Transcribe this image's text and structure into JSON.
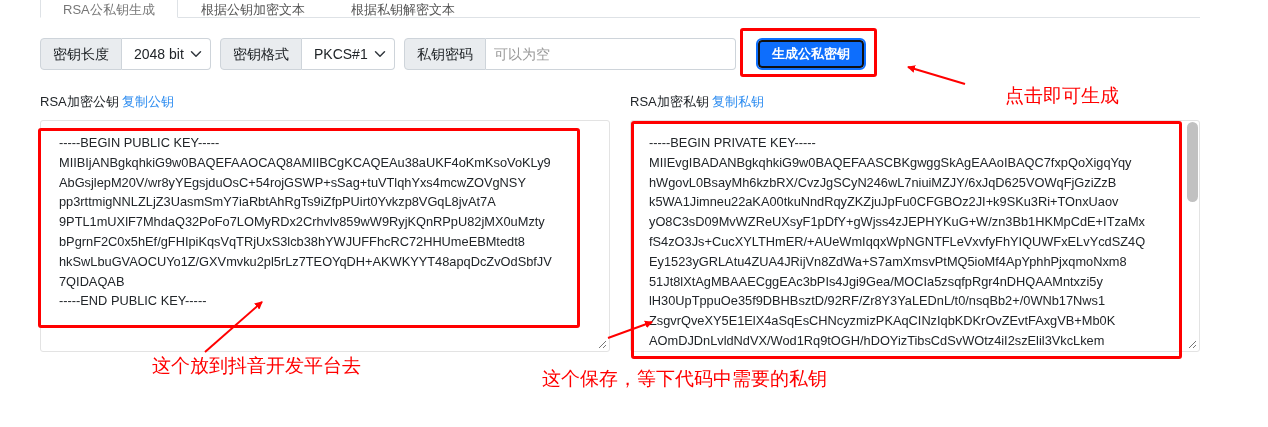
{
  "tabs": [
    {
      "label": "RSA公私钥生成",
      "selected": true
    },
    {
      "label": "根据公钥加密文本",
      "selected": false
    },
    {
      "label": "根据私钥解密文本",
      "selected": false
    }
  ],
  "options": [
    {
      "kind": "select",
      "label": "密钥长度",
      "value": "2048 bit"
    },
    {
      "kind": "select",
      "label": "密钥格式",
      "value": "PKCS#1"
    },
    {
      "kind": "input",
      "label": "私钥密码",
      "placeholder": "可以为空"
    }
  ],
  "generate_button": "生成公私密钥",
  "public_key": {
    "label": "RSA加密公钥",
    "copy_link": "复制公钥",
    "lines": [
      "-----BEGIN PUBLIC KEY-----",
      "MIIBIjANBgkqhkiG9w0BAQEFAAOCAQ8AMIIBCgKCAQEAu38aUKF4oKmKsoVoKLy9",
      "AbGsjlepM20V/wr8yYEgsjduOsC+54rojGSWP+sSag+tuVTlqhYxs4mcwZOVgNSY",
      "pp3rttmigNNLZLjZ3UasmSmY7iaRbtAhRgTs9iZfpPUirt0Yvkzp8VGqL8jvAt7A",
      "9PTL1mUXlF7MhdaQ32PoFo7LOMyRDx2Crhvlv859wW9RyjKQnRPpU82jMX0uMzty",
      "bPgrnF2C0x5hEf/gFHIpiKqsVqTRjUxS3lcb38hYWJUFFhcRC72HHUmeEBMtedt8",
      "hkSwLbuGVAOCUYo1Z/GXVmvku2pl5rLz7TEOYqDH+AKWKYYT48apqDcZvOdSbfJV",
      "7QIDAQAB",
      "-----END PUBLIC KEY-----"
    ]
  },
  "private_key": {
    "label": "RSA加密私钥",
    "copy_link": "复制私钥",
    "lines": [
      "-----BEGIN PRIVATE KEY-----",
      "MIIEvgIBADANBgkqhkiG9w0BAQEFAASCBKgwggSkAgEAAoIBAQC7fxpQoXigqYqy",
      "hWgovL0BsayMh6kzbRX/CvzJgSCyN246wL7niuiMZJY/6xJqD625VOWqFjGziZzB",
      "k5WA1Jimneu22aKA00tkuNndRqyZKZjuJpFu0CFGBOz2JI+k9SKu3Ri+TOnxUaov",
      "yO8C3sD09MvWZReUXsyF1pDfY+gWjss4zJEPHYKuG+W/zn3Bb1HKMpCdE+ITzaMx",
      "fS4zO3Js+CucXYLTHmER/+AUeWmIqqxWpNGNTFLeVxvfyFhYIQUWFxELvYcdSZ4Q",
      "Ey1523yGRLAtu4ZUA4JRijVn8ZdWa+S7amXmsvPtMQ5ioMf4ApYphhPjxqmoNxm8",
      "51Jt8lXtAgMBAAECggEAc3bPIs4Jgi9Gea/MOCIa5zsqfpRgr4nDHQAAMntxzi5y",
      "lH30UpTppuOe35f9DBHBsztD/92RF/Zr8Y3YaLEDnL/t0/nsqBb2+/0WNb17Nws1",
      "ZsgvrQveXY5E1ElX4aSqEsCHNcyzmizPKAqCINzIqbKDKrOvZEvtFAxgVB+Mb0K",
      "AOmDJDnLvldNdVX/Wod1Rq9tOGH/hDOYizTibsCdSvWOtz4iI2szElil3VkcLkem"
    ]
  },
  "annotations": [
    {
      "kind": "button-note",
      "text": "点击即可生成"
    },
    {
      "kind": "public-note",
      "text": "这个放到抖音开发平台去"
    },
    {
      "kind": "private-note",
      "text": "这个保存，等下代码中需要的私钥"
    }
  ]
}
